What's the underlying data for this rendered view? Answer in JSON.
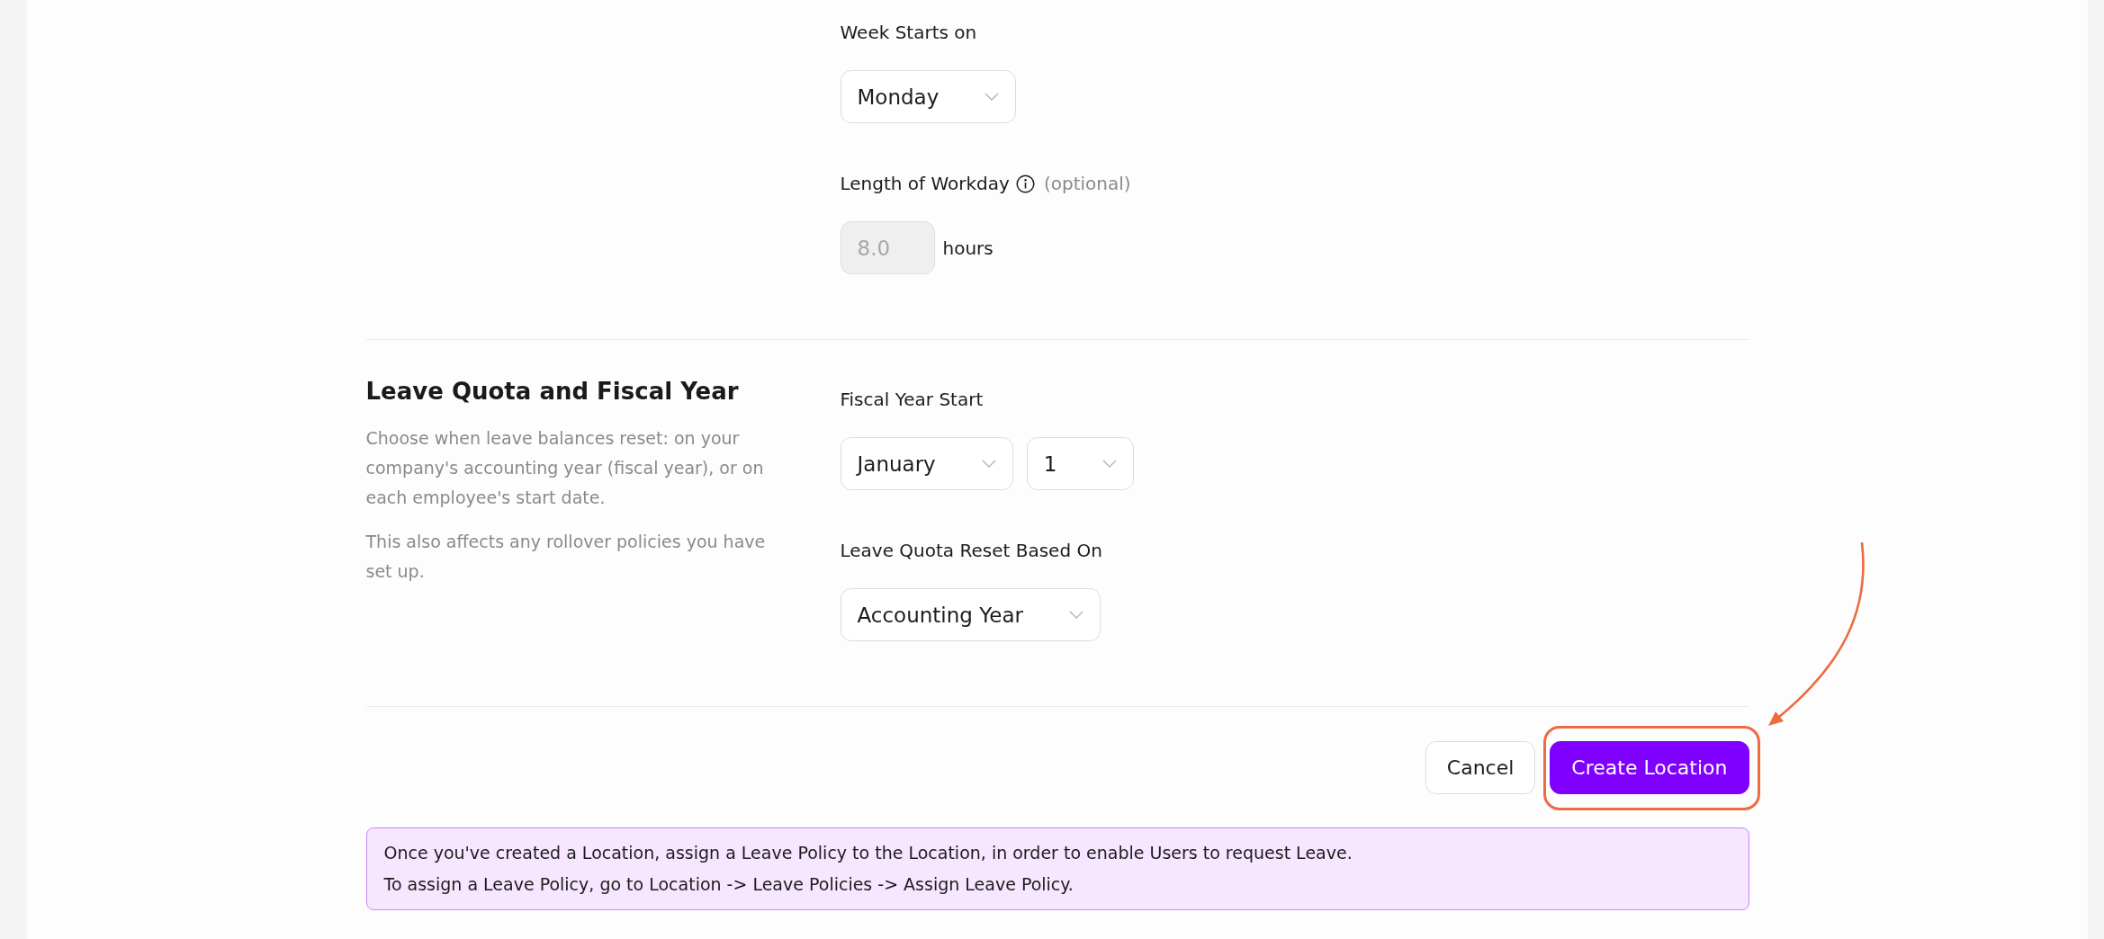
{
  "sections": [
    {
      "fields": [
        {
          "label": "Week Starts on",
          "info_icon": false,
          "controls": [
            {
              "kind": "select",
              "value": "Monday",
              "disabled": false
            }
          ]
        },
        {
          "label": "Length of Workday",
          "info_icon": true,
          "hint": "(optional)",
          "controls": [
            {
              "kind": "number",
              "placeholder": "8.0",
              "disabled": true,
              "unit": "hours"
            }
          ]
        }
      ]
    },
    {
      "title": "Leave Quota and Fiscal Year",
      "description": [
        "Choose when leave balances reset: on your company's accounting year (fiscal year), or on each employee's start date.",
        "This also affects any rollover policies you have set up."
      ],
      "fields": [
        {
          "label": "Fiscal Year Start",
          "info_icon": false,
          "controls": [
            {
              "kind": "select",
              "value": "January",
              "disabled": false
            },
            {
              "kind": "select",
              "value": "1",
              "disabled": false
            }
          ]
        },
        {
          "label": "Leave Quota Reset Based On",
          "info_icon": false,
          "controls": [
            {
              "kind": "select",
              "value": "Accounting Year",
              "disabled": false
            }
          ]
        }
      ]
    }
  ],
  "buttons": [
    {
      "label": "Cancel",
      "kind": "secondary",
      "highlighted": false
    },
    {
      "label": "Create Location",
      "kind": "primary",
      "highlighted": true
    }
  ],
  "notice": {
    "lines": [
      "Once you've created a Location, assign a Leave Policy to the Location, in order to enable Users to request Leave.",
      "To assign a Leave Policy, go to Location -> Leave Policies -> Assign Leave Policy."
    ]
  }
}
